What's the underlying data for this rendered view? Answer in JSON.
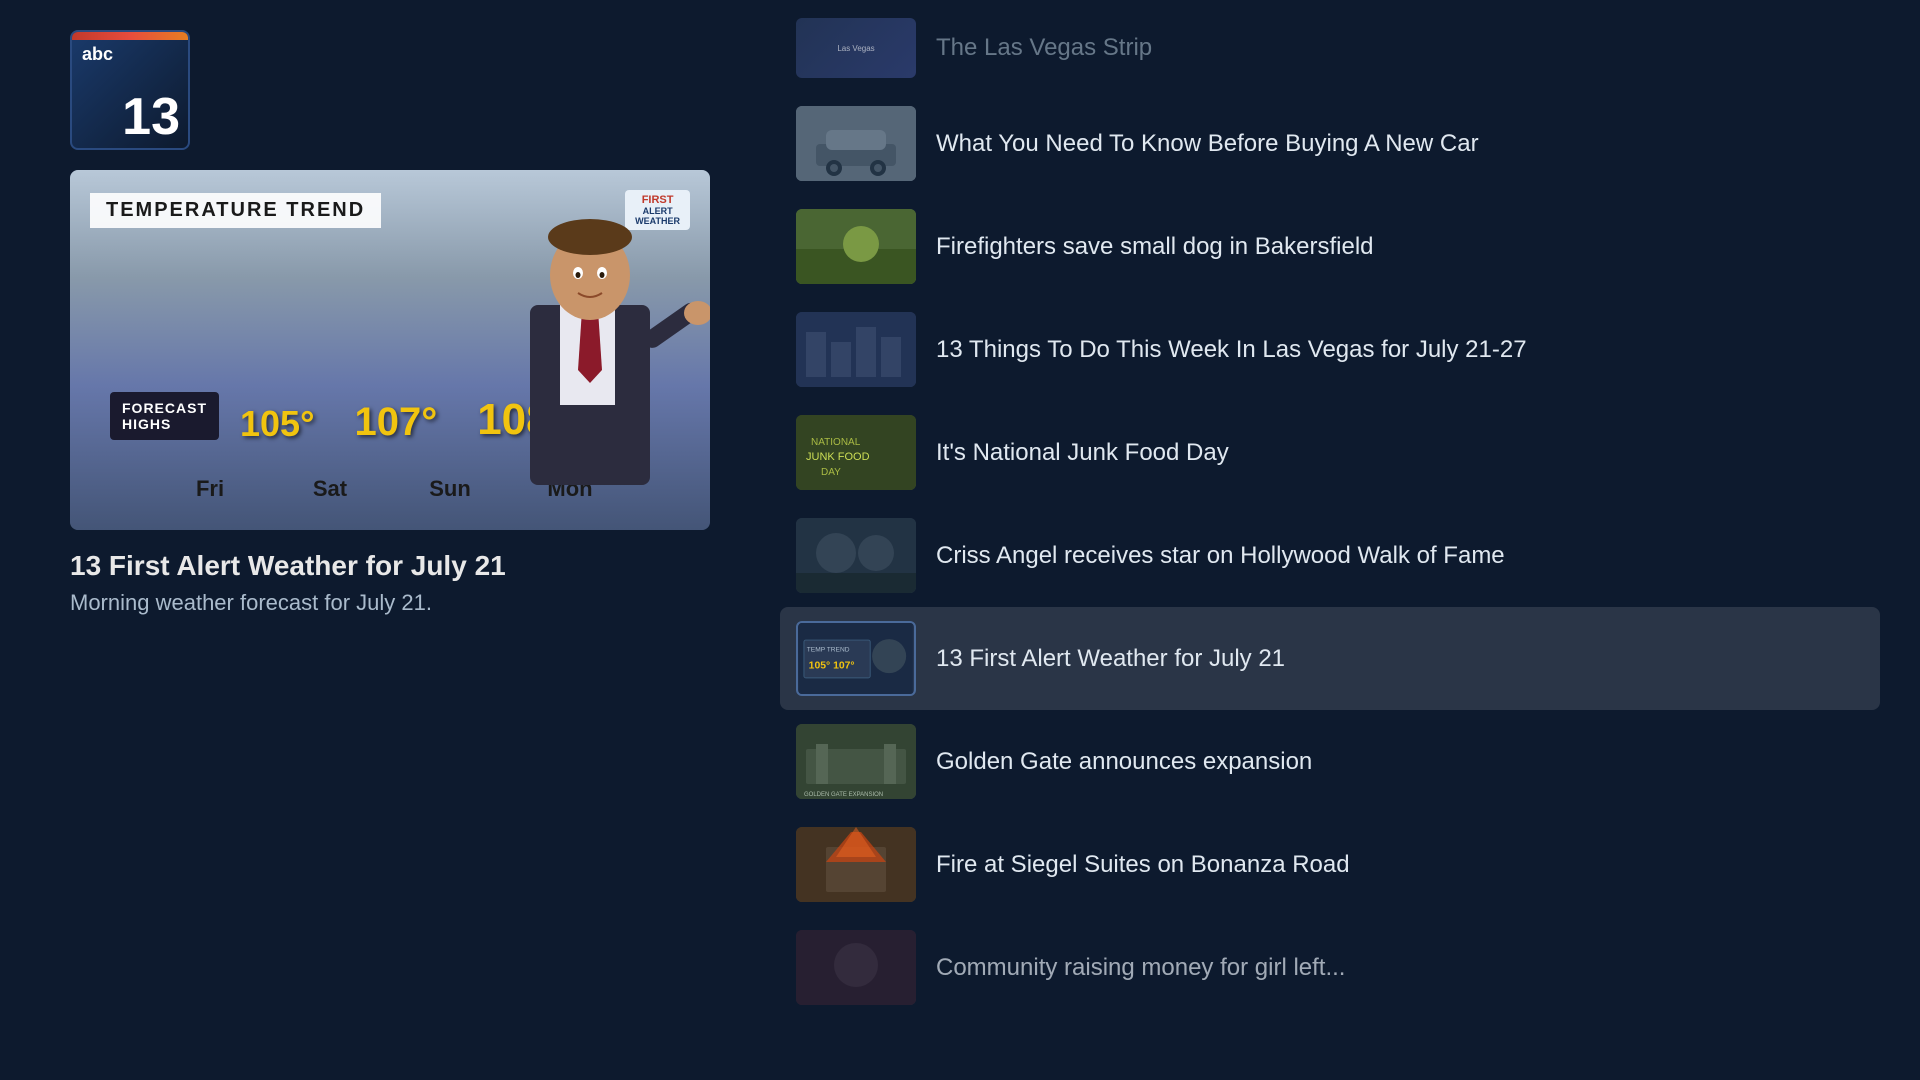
{
  "logo": {
    "abc_label": "abc",
    "number_label": "13"
  },
  "video": {
    "header": "TEMPERATURE TREND",
    "badge_line1": "FIRST",
    "badge_line2": "ALERT",
    "badge_line3": "WEATHER",
    "forecast_highs_line1": "FORECAST",
    "forecast_highs_line2": "HIGHS",
    "temps": [
      {
        "value": "105°",
        "size": 36
      },
      {
        "value": "107°",
        "size": 40
      },
      {
        "value": "108°",
        "size": 44
      }
    ],
    "days": [
      "Fri",
      "Sat",
      "Sun",
      "Mon"
    ]
  },
  "current_video": {
    "title": "13 First Alert Weather for July 21",
    "subtitle": "Morning weather forecast for July 21."
  },
  "news_items": [
    {
      "id": "las-vegas-strip",
      "text": "The Las Vegas Strip",
      "thumb_class": "thumb-lasvegas",
      "active": false,
      "partial": true
    },
    {
      "id": "new-car",
      "text": "What You Need To Know Before Buying A New Car",
      "thumb_class": "thumb-car",
      "active": false,
      "partial": false
    },
    {
      "id": "firefighters",
      "text": "Firefighters save small dog in Bakersfield",
      "thumb_class": "thumb-dog",
      "active": false,
      "partial": false
    },
    {
      "id": "13-things",
      "text": "13 Things To Do This Week In Las Vegas for July 21-27",
      "thumb_class": "thumb-vegas",
      "active": false,
      "partial": false
    },
    {
      "id": "junk-food",
      "text": "It's National Junk Food Day",
      "thumb_class": "thumb-junkfood",
      "active": false,
      "partial": false
    },
    {
      "id": "criss-angel",
      "text": "Criss Angel receives star on Hollywood Walk of Fame",
      "thumb_class": "thumb-criss",
      "active": false,
      "partial": false
    },
    {
      "id": "weather-july21",
      "text": "13 First Alert Weather for July 21",
      "thumb_class": "thumb-weather",
      "active": true,
      "partial": false
    },
    {
      "id": "golden-gate",
      "text": "Golden Gate announces expansion",
      "thumb_class": "thumb-golden",
      "active": false,
      "partial": false
    },
    {
      "id": "siegel-suites",
      "text": "Fire at Siegel Suites on Bonanza Road",
      "thumb_class": "thumb-siegel",
      "active": false,
      "partial": false
    },
    {
      "id": "community",
      "text": "Community raising money for girl left...",
      "thumb_class": "thumb-community",
      "active": false,
      "partial": true
    }
  ]
}
